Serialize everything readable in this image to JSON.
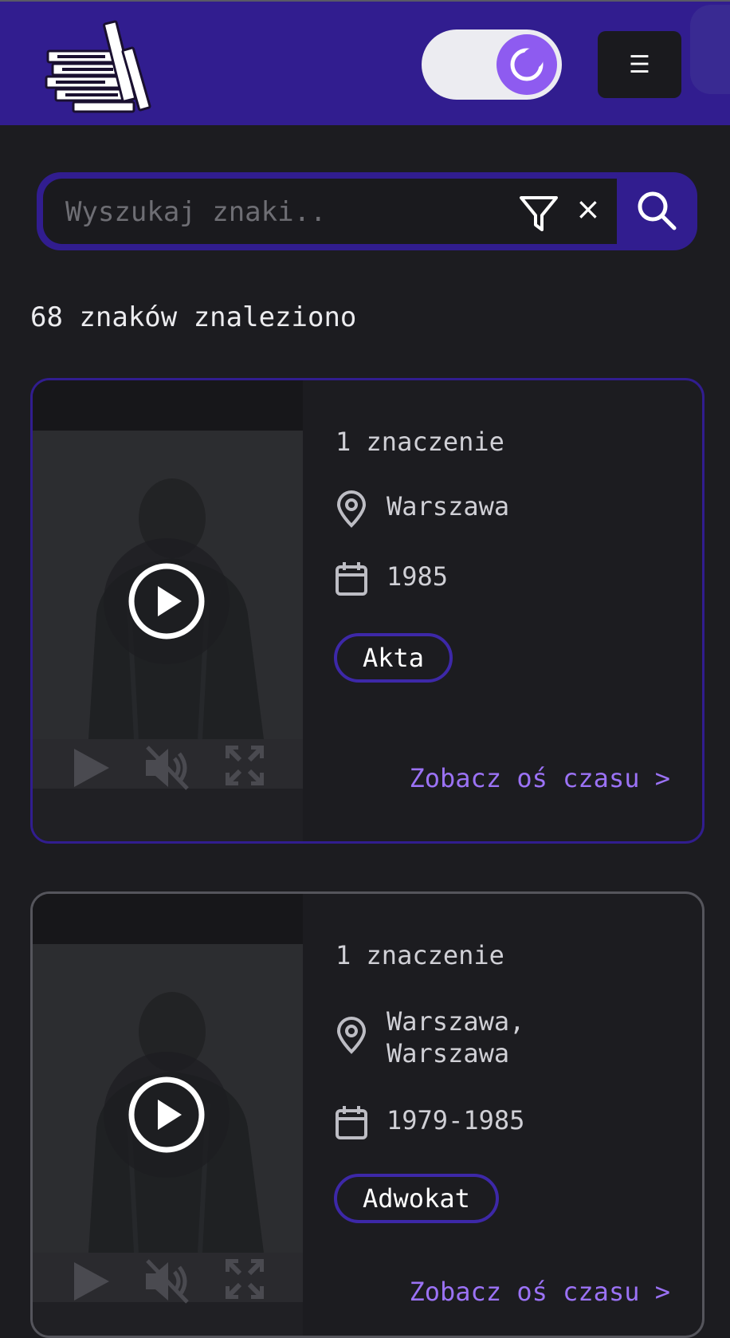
{
  "header": {
    "logo_icon": "books-logo-icon",
    "theme_toggle_icon": "moon-icon",
    "menu_icon": "☰"
  },
  "search": {
    "placeholder": "Wyszukaj znaki..",
    "value": "",
    "filter_icon": "filter-icon",
    "clear_label": "×",
    "submit_icon": "search-icon"
  },
  "results": {
    "count_text": "68 znaków znaleziono",
    "items": [
      {
        "meanings": "1 znaczenie",
        "location": "Warszawa",
        "date": "1985",
        "tag": "Akta",
        "timeline_link": "Zobacz oś czasu >"
      },
      {
        "meanings": "1 znaczenie",
        "location_line1": "Warszawa,",
        "location_line2": "Warszawa",
        "date": "1979-1985",
        "tag": "Adwokat",
        "timeline_link": "Zobacz oś czasu >"
      }
    ]
  },
  "colors": {
    "brand": "#311d8f",
    "accent": "#8e5bf0",
    "link": "#9b72f5",
    "background": "#1c1c20"
  }
}
